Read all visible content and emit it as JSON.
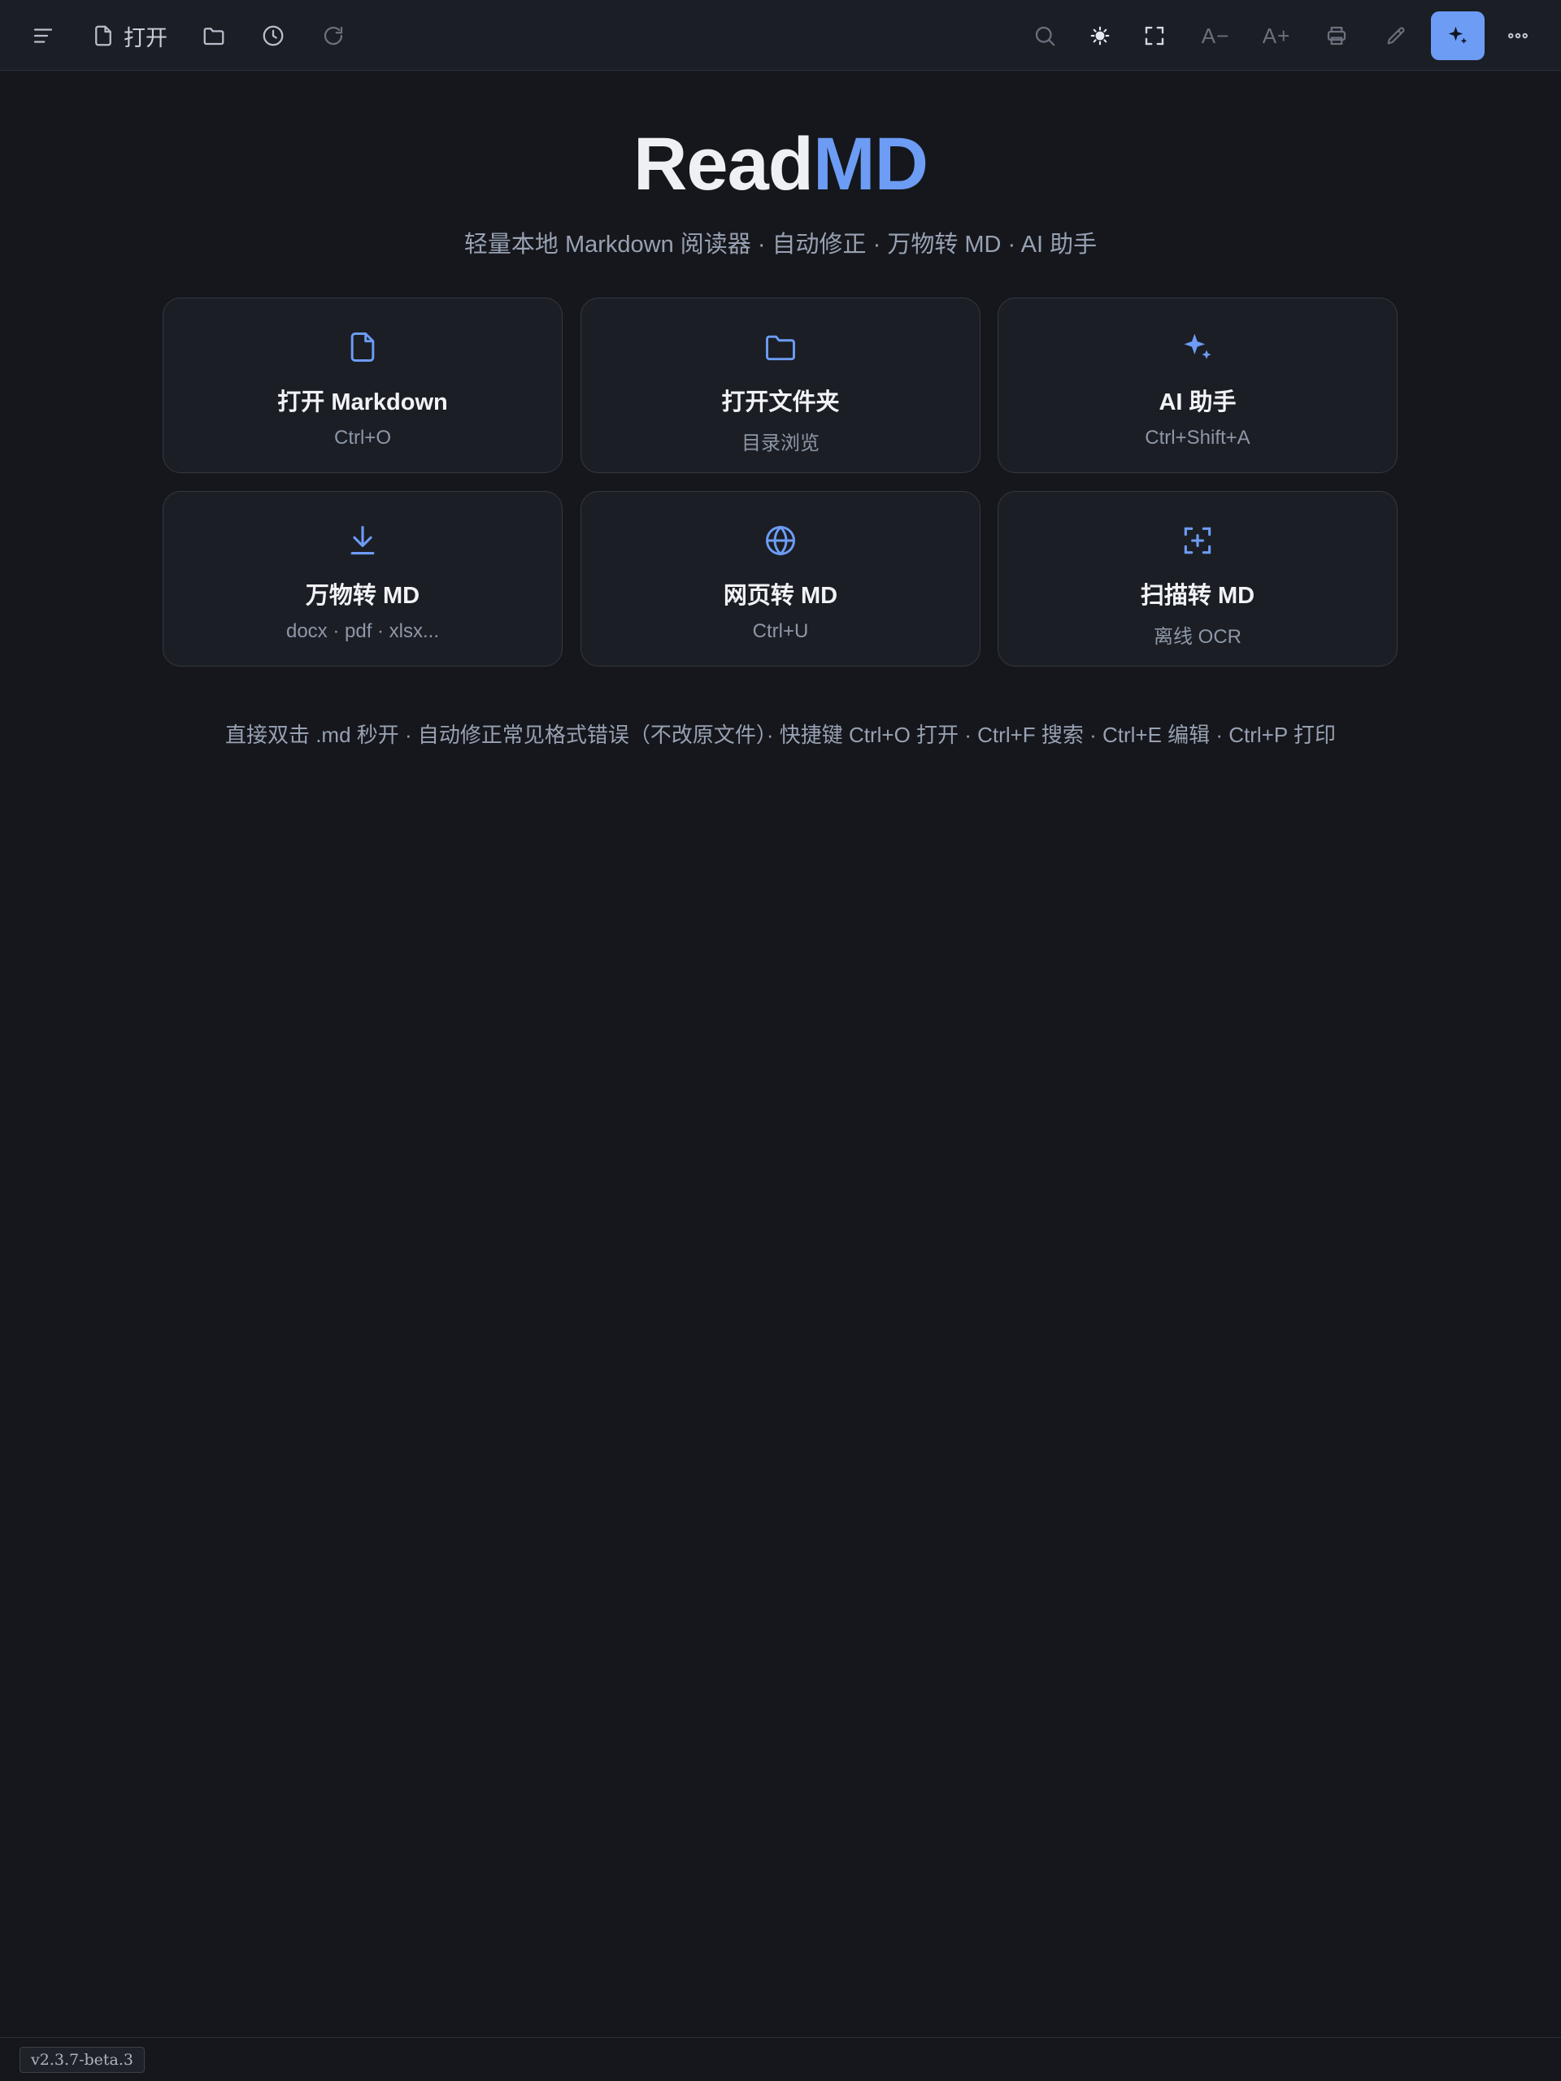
{
  "toolbar": {
    "open_label": "打开",
    "font_decrease_label": "A−",
    "font_increase_label": "A+",
    "icons": [
      "menu-icon",
      "file-icon",
      "folder-icon",
      "clock-icon",
      "refresh-icon",
      "search-icon",
      "sun-icon",
      "fullscreen-icon",
      "printer-icon",
      "pencil-icon",
      "sparkle-icon",
      "more-icon"
    ]
  },
  "hero": {
    "title_part1": "Read",
    "title_part2": "MD",
    "subtitle": "轻量本地 Markdown 阅读器 · 自动修正 · 万物转 MD · AI 助手"
  },
  "cards": [
    {
      "icon": "file-icon",
      "title": "打开 Markdown",
      "subtitle": "Ctrl+O"
    },
    {
      "icon": "folder-icon",
      "title": "打开文件夹",
      "subtitle": "目录浏览"
    },
    {
      "icon": "sparkle-icon",
      "title": "AI 助手",
      "subtitle": "Ctrl+Shift+A"
    },
    {
      "icon": "download-icon",
      "title": "万物转 MD",
      "subtitle": "docx · pdf · xlsx..."
    },
    {
      "icon": "globe-icon",
      "title": "网页转 MD",
      "subtitle": "Ctrl+U"
    },
    {
      "icon": "scan-icon",
      "title": "扫描转 MD",
      "subtitle": "离线 OCR"
    }
  ],
  "hint": "直接双击 .md 秒开 · 自动修正常见格式错误（不改原文件）· 快捷键 Ctrl+O 打开 · Ctrl+F 搜索 · Ctrl+E 编辑 · Ctrl+P 打印",
  "status": {
    "version": "v2.3.7-beta.3"
  },
  "colors": {
    "background": "#15171c",
    "toolbar": "#1b1e25",
    "accent": "#6d9cf5",
    "card_border": "#343842",
    "muted_text": "#98a1b2"
  }
}
